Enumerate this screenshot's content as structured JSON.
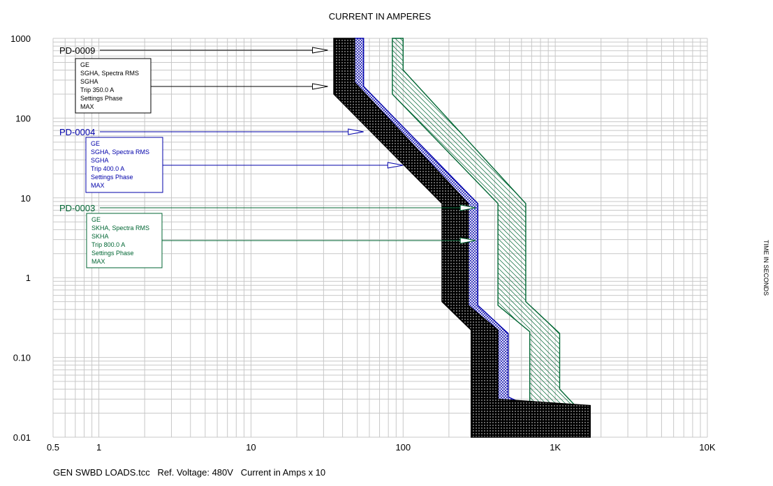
{
  "chart_data": {
    "type": "line",
    "title": "CURRENT IN AMPERES",
    "ylabel": "TIME IN SECONDS",
    "footer": "GEN SWBD LOADS.tcc   Ref. Voltage: 480V   Current in Amps x 10",
    "x_scale": "log",
    "y_scale": "log",
    "xlim": [
      0.5,
      10000
    ],
    "ylim": [
      0.01,
      1000
    ],
    "x_ticks": [
      "0.5",
      "1",
      "10",
      "100",
      "1K",
      "10K"
    ],
    "y_ticks": [
      "1000",
      "100",
      "10",
      "1",
      "0.10",
      "0.01"
    ],
    "grid": true,
    "series": [
      {
        "name": "PD-0009",
        "color": "#000000",
        "fill": "solid",
        "box_lines": [
          "GE",
          "SGHA, Spectra RMS",
          "SGHA",
          "Trip 350.0 A",
          "Settings Phase",
          "   MAX"
        ],
        "left_edge": [
          [
            35,
            1000
          ],
          [
            35,
            200
          ],
          [
            180,
            8.5
          ],
          [
            180,
            0.5
          ],
          [
            280,
            0.22
          ],
          [
            280,
            0.01
          ]
        ],
        "right_edge": [
          [
            48,
            1000
          ],
          [
            48,
            280
          ],
          [
            268,
            8.5
          ],
          [
            268,
            0.45
          ],
          [
            420,
            0.22
          ],
          [
            420,
            0.03
          ],
          [
            1700,
            0.025
          ],
          [
            1700,
            0.01
          ]
        ],
        "arrows_at": [
          32,
          32
        ]
      },
      {
        "name": "PD-0004",
        "color": "#0000aa",
        "fill": "crosshatch",
        "box_lines": [
          "GE",
          "SGHA, Spectra RMS",
          "SGHA",
          "Trip 400.0 A",
          "Settings Phase",
          "   MAX"
        ],
        "left_edge": [
          [
            48,
            1000
          ],
          [
            48,
            280
          ],
          [
            268,
            8.5
          ],
          [
            268,
            0.45
          ],
          [
            420,
            0.22
          ],
          [
            420,
            0.03
          ],
          [
            500,
            0.025
          ]
        ],
        "right_edge": [
          [
            55,
            1000
          ],
          [
            55,
            250
          ],
          [
            310,
            8.5
          ],
          [
            310,
            0.45
          ],
          [
            490,
            0.2
          ],
          [
            490,
            0.032
          ],
          [
            650,
            0.025
          ]
        ],
        "arrows_at": [
          55,
          100
        ]
      },
      {
        "name": "PD-0003",
        "color": "#006633",
        "fill": "diagonal-hatch",
        "box_lines": [
          "GE",
          "SKHA, Spectra RMS",
          "SKHA",
          "Trip 800.0 A",
          "Settings Phase",
          "   MAX"
        ],
        "left_edge": [
          [
            85,
            1000
          ],
          [
            85,
            200
          ],
          [
            420,
            8.5
          ],
          [
            420,
            0.45
          ],
          [
            680,
            0.21
          ],
          [
            680,
            0.025
          ]
        ],
        "right_edge": [
          [
            100,
            1000
          ],
          [
            100,
            400
          ],
          [
            640,
            8.5
          ],
          [
            640,
            0.5
          ],
          [
            1070,
            0.2
          ],
          [
            1070,
            0.04
          ],
          [
            1350,
            0.025
          ]
        ],
        "arrows_at": [
          300,
          300
        ]
      }
    ]
  }
}
